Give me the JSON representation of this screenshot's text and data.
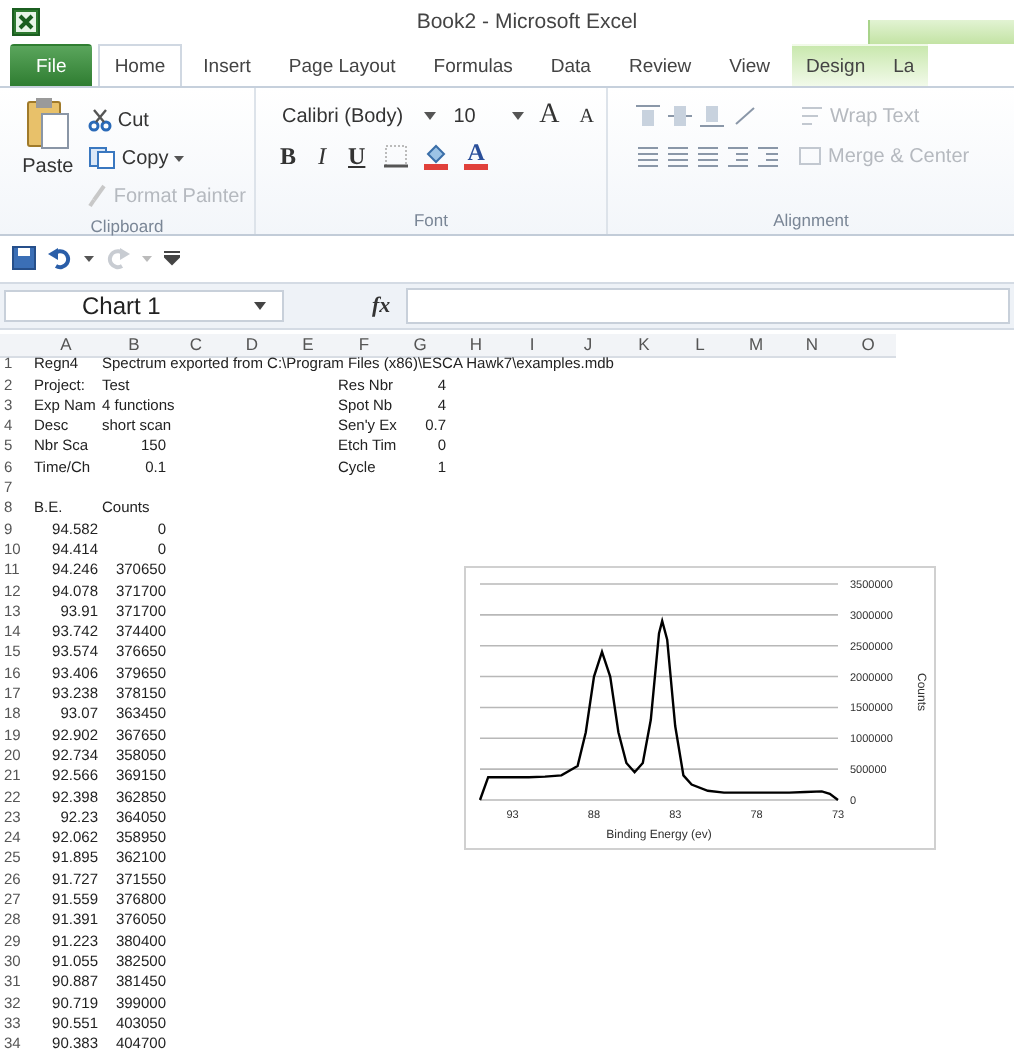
{
  "window": {
    "title": "Book2 - Microsoft Excel"
  },
  "tabs": [
    {
      "label": "File",
      "kind": "file",
      "selected": false
    },
    {
      "label": "Home",
      "kind": "normal",
      "selected": true
    },
    {
      "label": "Insert",
      "kind": "normal",
      "selected": false
    },
    {
      "label": "Page Layout",
      "kind": "normal",
      "selected": false
    },
    {
      "label": "Formulas",
      "kind": "normal",
      "selected": false
    },
    {
      "label": "Data",
      "kind": "normal",
      "selected": false
    },
    {
      "label": "Review",
      "kind": "normal",
      "selected": false
    },
    {
      "label": "View",
      "kind": "normal",
      "selected": false
    },
    {
      "label": "Design",
      "kind": "contextual",
      "selected": false
    },
    {
      "label": "La",
      "kind": "contextual",
      "selected": false
    }
  ],
  "ribbon": {
    "clipboard": {
      "label": "Clipboard",
      "paste": "Paste",
      "cut": "Cut",
      "copy": "Copy",
      "format_painter": {
        "label": "Format Painter",
        "disabled": true
      }
    },
    "font": {
      "label": "Font",
      "name": "Calibri (Body)",
      "size": "10",
      "grow": "A",
      "shrink": "A",
      "bold": "B",
      "italic": "I",
      "underline": "U",
      "font_color": "A"
    },
    "alignment": {
      "label": "Alignment",
      "wrap_text": {
        "label": "Wrap Text",
        "disabled": true
      },
      "merge": {
        "label": "Merge & Center",
        "disabled": true
      }
    }
  },
  "quick_access": {
    "redo_disabled": true
  },
  "formula_bar": {
    "name_box": "Chart 1",
    "function_label": "fx"
  },
  "columns": [
    "A",
    "B",
    "C",
    "D",
    "E",
    "F",
    "G",
    "H",
    "I",
    "J",
    "K",
    "L",
    "M",
    "N",
    "O"
  ],
  "rows": [
    {
      "number": "1",
      "a": "Regn4",
      "b": "Spectrum exported from C:\\Program Files (x86)\\ESCA Hawk7\\examples.mdb"
    },
    {
      "number": "2",
      "a": "Project:",
      "b": "Test",
      "f": "Res Nbr",
      "g": "4"
    },
    {
      "number": "3",
      "a": "Exp Nam",
      "b": "4 functions",
      "f": "Spot Nb",
      "g": "4"
    },
    {
      "number": "4",
      "a": "Desc",
      "b": "short scan",
      "f": "Sen'y Ex",
      "g": "0.7"
    },
    {
      "number": "5",
      "a": "Nbr Sca",
      "b": "150",
      "f": "Etch Tim",
      "g": "0"
    },
    {
      "number": "6",
      "a": "Time/Ch",
      "b": "0.1",
      "f": "Cycle",
      "g": "1"
    },
    {
      "number": "7"
    },
    {
      "number": "8",
      "a": "B.E.",
      "b": "Counts"
    },
    {
      "number": "9",
      "a": "94.582",
      "b": "0"
    },
    {
      "number": "10",
      "a": "94.414",
      "b": "0"
    },
    {
      "number": "11",
      "a": "94.246",
      "b": "370650"
    },
    {
      "number": "12",
      "a": "94.078",
      "b": "371700"
    },
    {
      "number": "13",
      "a": "93.91",
      "b": "371700"
    },
    {
      "number": "14",
      "a": "93.742",
      "b": "374400"
    },
    {
      "number": "15",
      "a": "93.574",
      "b": "376650"
    },
    {
      "number": "16",
      "a": "93.406",
      "b": "379650"
    },
    {
      "number": "17",
      "a": "93.238",
      "b": "378150"
    },
    {
      "number": "18",
      "a": "93.07",
      "b": "363450"
    },
    {
      "number": "19",
      "a": "92.902",
      "b": "367650"
    },
    {
      "number": "20",
      "a": "92.734",
      "b": "358050"
    },
    {
      "number": "21",
      "a": "92.566",
      "b": "369150"
    },
    {
      "number": "22",
      "a": "92.398",
      "b": "362850"
    },
    {
      "number": "23",
      "a": "92.23",
      "b": "364050"
    },
    {
      "number": "24",
      "a": "92.062",
      "b": "358950"
    },
    {
      "number": "25",
      "a": "91.895",
      "b": "362100"
    },
    {
      "number": "26",
      "a": "91.727",
      "b": "371550"
    },
    {
      "number": "27",
      "a": "91.559",
      "b": "376800"
    },
    {
      "number": "28",
      "a": "91.391",
      "b": "376050"
    },
    {
      "number": "29",
      "a": "91.223",
      "b": "380400"
    },
    {
      "number": "30",
      "a": "91.055",
      "b": "382500"
    },
    {
      "number": "31",
      "a": "90.887",
      "b": "381450"
    },
    {
      "number": "32",
      "a": "90.719",
      "b": "399000"
    },
    {
      "number": "33",
      "a": "90.551",
      "b": "403050"
    },
    {
      "number": "34",
      "a": "90.383",
      "b": "404700"
    }
  ],
  "chart": {
    "chart_data": {
      "type": "line",
      "xlabel": "Binding Energy (ev)",
      "ylabel": "Counts",
      "xlim": [
        95,
        73
      ],
      "ylim": [
        0,
        3500000
      ],
      "xticks": [
        93,
        88,
        83,
        78,
        73
      ],
      "yticks": [
        0,
        500000,
        1000000,
        1500000,
        2000000,
        2500000,
        3000000,
        3500000
      ],
      "x": [
        95,
        94.5,
        94,
        93,
        92,
        91,
        90,
        89,
        88.5,
        88,
        87.5,
        87,
        86.5,
        86,
        85.5,
        85,
        84.5,
        84,
        83.8,
        83.5,
        83,
        82.5,
        82,
        81,
        80,
        79,
        78,
        77,
        76,
        75,
        74,
        73.5,
        73
      ],
      "grid": true,
      "series": [
        {
          "color": "#000000",
          "values": [
            0,
            370000,
            370000,
            370000,
            370000,
            380000,
            400000,
            550000,
            1100000,
            2000000,
            2400000,
            2000000,
            1100000,
            600000,
            450000,
            600000,
            1300000,
            2700000,
            2900000,
            2600000,
            1200000,
            400000,
            250000,
            150000,
            120000,
            120000,
            120000,
            120000,
            120000,
            130000,
            140000,
            100000,
            0
          ]
        }
      ]
    }
  }
}
